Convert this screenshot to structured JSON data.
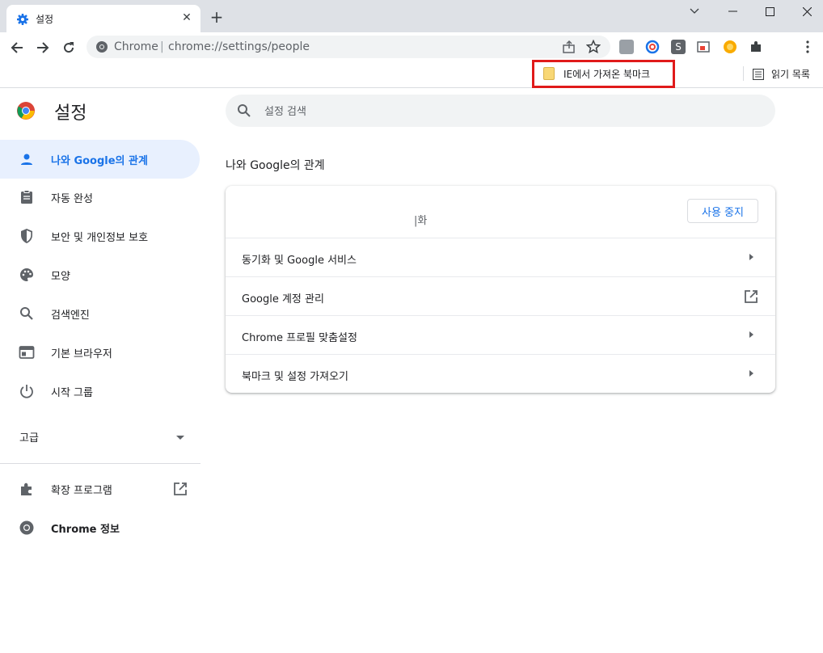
{
  "tab": {
    "title": "설정",
    "close_glyph": "✕",
    "new_tab_glyph": "+"
  },
  "window_controls": {
    "minimize_glyph": "─",
    "maximize_glyph": "□",
    "close_glyph": "✕",
    "dropdown_glyph": "⌄"
  },
  "omnibox": {
    "site": "Chrome",
    "separator": "|",
    "url": "chrome://settings/people"
  },
  "bookmarks_bar": {
    "imported_folder": "IE에서 가져온 북마크",
    "reading_list": "읽기 목록"
  },
  "settings": {
    "title": "설정",
    "search_placeholder": "설정 검색",
    "nav": [
      {
        "label": "나와 Google의 관계",
        "icon": "person-icon",
        "active": true
      },
      {
        "label": "자동 완성",
        "icon": "clipboard-icon"
      },
      {
        "label": "보안 및 개인정보 보호",
        "icon": "shield-icon"
      },
      {
        "label": "모양",
        "icon": "palette-icon"
      },
      {
        "label": "검색엔진",
        "icon": "search-icon"
      },
      {
        "label": "기본 브라우저",
        "icon": "browser-icon"
      },
      {
        "label": "시작 그룹",
        "icon": "power-icon"
      }
    ],
    "advanced": "고급",
    "extensions": "확장 프로그램",
    "about": "Chrome 정보"
  },
  "people": {
    "section_title": "나와 Google의 관계",
    "sync_status": "|화",
    "stop_button": "사용 중지",
    "rows": [
      {
        "label": "동기화 및 Google 서비스",
        "action": "arrow"
      },
      {
        "label": "Google 계정 관리",
        "action": "external-link"
      },
      {
        "label": "Chrome 프로필 맞춤설정",
        "action": "arrow"
      },
      {
        "label": "북마크 및 설정 가져오기",
        "action": "arrow"
      }
    ]
  },
  "colors": {
    "accent": "#1a73e8",
    "highlight_box": "#e01a1a",
    "active_nav_bg": "#e8f0fe"
  }
}
